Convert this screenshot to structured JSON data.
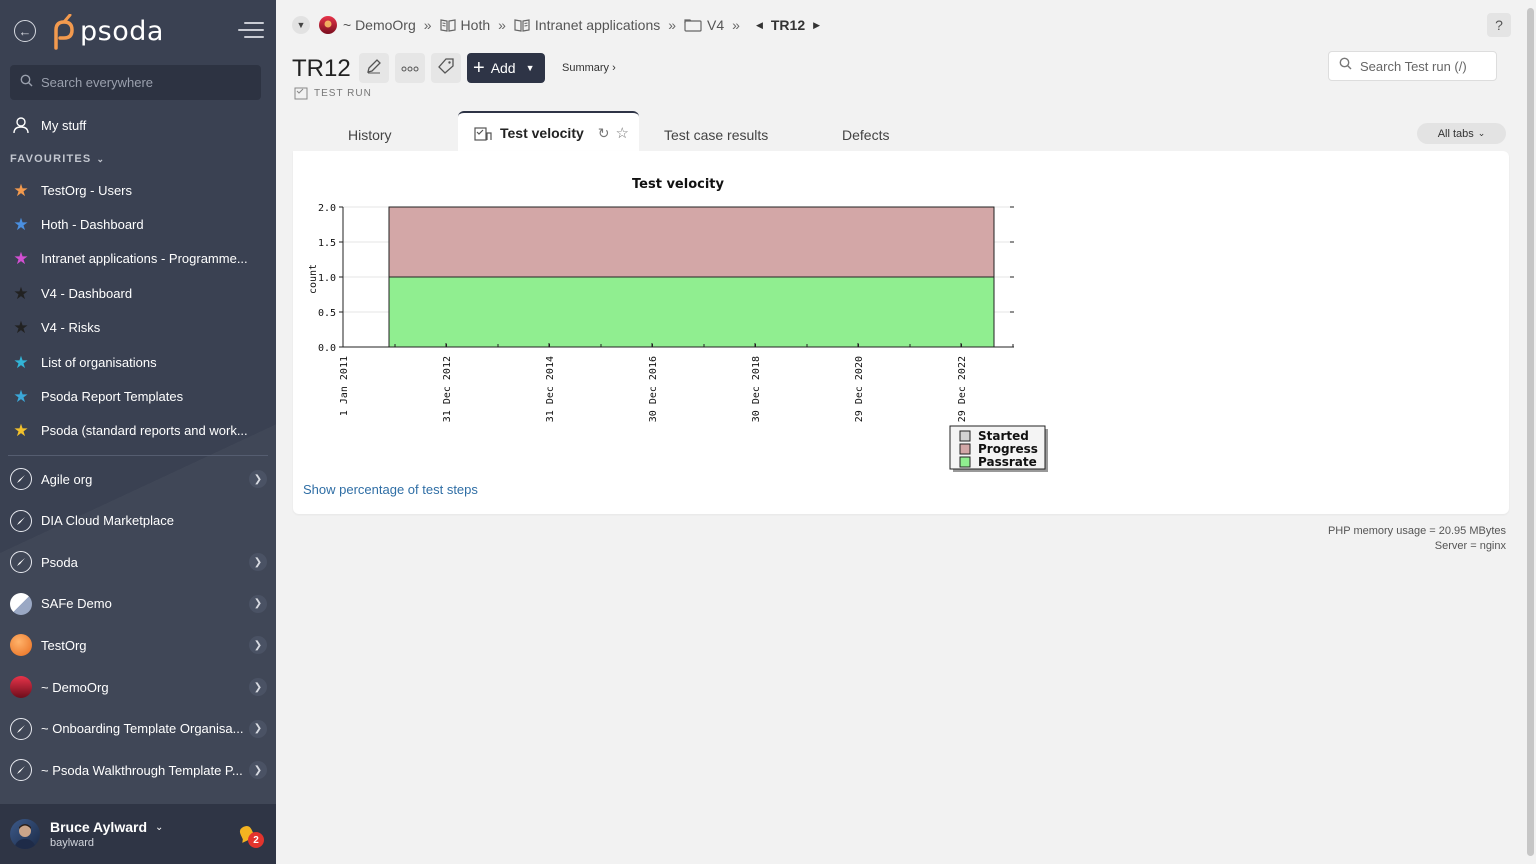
{
  "sidebar": {
    "logo_text": "psoda",
    "search_placeholder": "Search everywhere",
    "my_stuff": "My stuff",
    "favourites_label": "FAVOURITES",
    "favourites": [
      {
        "label": "TestOrg - Users",
        "star_color": "#f39a4e"
      },
      {
        "label": "Hoth - Dashboard",
        "star_color": "#4a8fe0"
      },
      {
        "label": "Intranet applications - Programme...",
        "star_color": "#d24fd2"
      },
      {
        "label": "V4 - Dashboard",
        "star_color": "#222222"
      },
      {
        "label": "V4 - Risks",
        "star_color": "#222222"
      },
      {
        "label": "List of organisations",
        "star_color": "#32b4d6"
      },
      {
        "label": "Psoda Report Templates",
        "star_color": "#3ba8d9"
      },
      {
        "label": "Psoda (standard reports and work...",
        "star_color": "#f2c12c"
      }
    ],
    "organisations": [
      {
        "label": "Agile org",
        "icon": "compass-icon",
        "arrow": true
      },
      {
        "label": "DIA Cloud Marketplace",
        "icon": "compass-icon",
        "arrow": false
      },
      {
        "label": "Psoda",
        "icon": "compass-icon",
        "arrow": true
      },
      {
        "label": "SAFe Demo",
        "icon": "safe-logo-icon",
        "arrow": true
      },
      {
        "label": "TestOrg",
        "icon": "orange-globe-icon",
        "arrow": true
      },
      {
        "label": "~ DemoOrg",
        "icon": "sunset-icon",
        "arrow": true
      },
      {
        "label": "~ Onboarding Template Organisa...",
        "icon": "compass-icon",
        "arrow": true
      },
      {
        "label": "~ Psoda Walkthrough Template P...",
        "icon": "compass-icon",
        "arrow": true
      }
    ],
    "user": {
      "name": "Bruce Aylward",
      "login": "baylward",
      "notifications": "2"
    }
  },
  "breadcrumbs": {
    "items": [
      "~ DemoOrg",
      "Hoth",
      "Intranet applications",
      "V4"
    ],
    "current": "TR12"
  },
  "header": {
    "title": "TR12",
    "subtitle": "TEST RUN",
    "add_label": "Add",
    "summary_label": "Summary ›",
    "search_placeholder": "Search Test run (/)",
    "help": "?"
  },
  "tabs": {
    "items": [
      "History",
      "Test velocity",
      "Test case results",
      "Defects"
    ],
    "active": "Test velocity",
    "all_tabs_label": "All tabs"
  },
  "panel": {
    "link": "Show percentage of test steps"
  },
  "chart_data": {
    "type": "area",
    "title": "Test velocity",
    "ylabel": "count",
    "xlabel": "",
    "ylim": [
      0,
      2.0
    ],
    "yticks": [
      "0.0",
      "0.5",
      "1.0",
      "1.5",
      "2.0"
    ],
    "xticks": [
      "1 Jan 2011",
      "31 Dec 2012",
      "31 Dec 2014",
      "30 Dec 2016",
      "30 Dec 2018",
      "29 Dec 2020",
      "29 Dec 2022"
    ],
    "x_range": [
      "2011-11-01",
      "2023-09-01"
    ],
    "series": [
      {
        "name": "Started",
        "value": 0,
        "color": "#d3d3d3"
      },
      {
        "name": "Progress",
        "value": 1,
        "color": "#d3a7a7"
      },
      {
        "name": "Passrate",
        "value": 1,
        "color": "#90ee90"
      }
    ],
    "legend": "bottom-right"
  },
  "footer": {
    "memory": "PHP memory usage = 20.95 MBytes",
    "server": "Server = nginx"
  }
}
